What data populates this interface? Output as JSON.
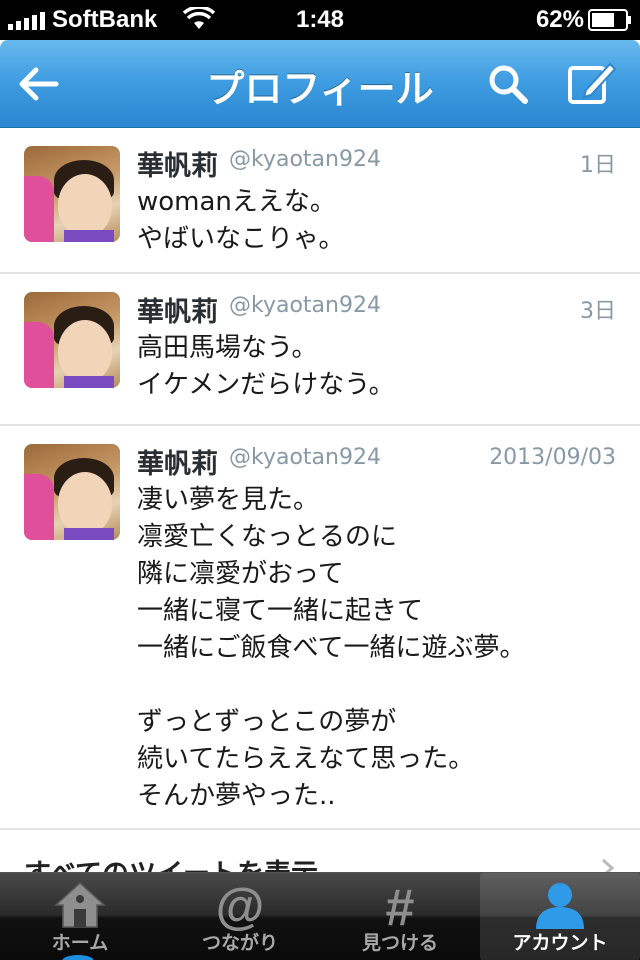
{
  "status_bar": {
    "carrier": "SoftBank",
    "time": "1:48",
    "battery": "62%"
  },
  "nav": {
    "title": "プロフィール",
    "back_icon": "back-arrow-icon",
    "search_icon": "search-icon",
    "compose_icon": "compose-icon"
  },
  "tweets": [
    {
      "name": "華帆莉",
      "handle": "@kyaotan924",
      "time": "1日",
      "text": "womanええな。\nやばいなこりゃ。"
    },
    {
      "name": "華帆莉",
      "handle": "@kyaotan924",
      "time": "3日",
      "text": "高田馬場なう。\nイケメンだらけなう。"
    },
    {
      "name": "華帆莉",
      "handle": "@kyaotan924",
      "time": "2013/09/03",
      "text": "凄い夢を見た。\n凛愛亡くなっとるのに\n隣に凛愛がおって\n一緒に寝て一緒に起きて\n一緒にご飯食べて一緒に遊ぶ夢。\n\nずっとずっとこの夢が\n続いてたらええなて思った。\nそんか夢やった.."
    }
  ],
  "more": {
    "label": "すべてのツイートを表示"
  },
  "tabs": [
    {
      "label": "ホーム",
      "icon": "home-icon",
      "active": false
    },
    {
      "label": "つながり",
      "icon": "at-icon",
      "active": false
    },
    {
      "label": "見つける",
      "icon": "hash-icon",
      "active": false
    },
    {
      "label": "アカウント",
      "icon": "account-icon",
      "active": true
    }
  ],
  "colors": {
    "nav_blue": "#3d9be0",
    "active_tab_icon": "#2f9ae8",
    "handle_gray": "#8899a6"
  }
}
